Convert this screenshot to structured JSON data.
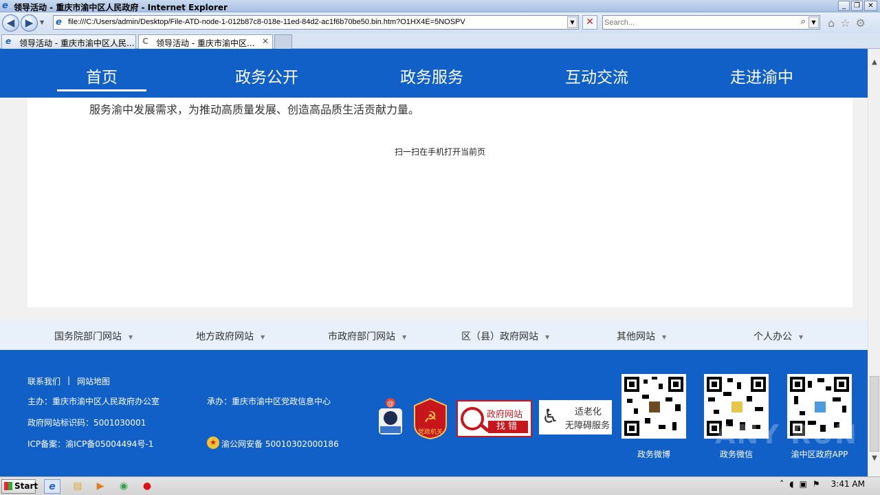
{
  "window": {
    "title": "领导活动 - 重庆市渝中区人民政府 - Internet Explorer"
  },
  "addressbar": {
    "url": "file:///C:/Users/admin/Desktop/File-ATD-node-1-012b87c8-018e-11ed-84d2-ac1f6b70be50.bin.htm?O1HX4E=5NOSPV",
    "search_placeholder": "Search..."
  },
  "tabs": [
    {
      "label": "领导活动 - 重庆市渝中区人民..."
    },
    {
      "label": "领导活动 - 重庆市渝中区..."
    }
  ],
  "site_nav": [
    "首页",
    "政务公开",
    "政务服务",
    "互动交流",
    "走进渝中"
  ],
  "content": {
    "text": "服务渝中发展需求，为推动高质量发展、创造高品质生活贡献力量。",
    "qr_caption": "扫一扫在手机打开当前页"
  },
  "links_bar": [
    "国务院部门网站",
    "地方政府网站",
    "市政府部门网站",
    "区（县）政府网站",
    "其他网站",
    "个人办公"
  ],
  "footer": {
    "contact": "联系我们",
    "separator": "|",
    "sitemap": "网站地图",
    "host": "主办：重庆市渝中区人民政府办公室",
    "organizer": "承办：重庆市渝中区党政信息中心",
    "site_id": "政府网站标识码：5001030001",
    "icp": "ICP备案：渝ICP备05004494号-1",
    "police": "渝公网安备 50010302000186",
    "error_badge_top": "政府网站",
    "error_badge_bottom": "找错",
    "party_badge": "党政机关",
    "access_badge_line1": "适老化",
    "access_badge_line2": "无障碍服务",
    "qr_labels": [
      "政务微博",
      "政务微信",
      "渝中区政府APP"
    ]
  },
  "taskbar": {
    "start": "Start",
    "time": "3:41 AM"
  },
  "watermark": "ANY RUN",
  "colors": {
    "nav_blue": "#1160c8",
    "links_bg": "#e8f0fa",
    "error_red": "#c8161d"
  }
}
